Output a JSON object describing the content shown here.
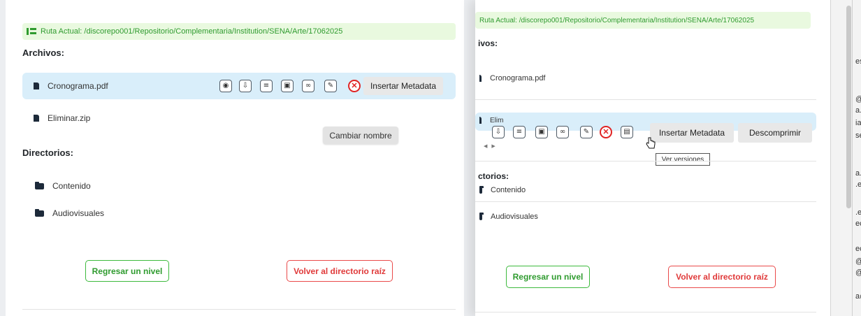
{
  "left_panel": {
    "path_label": "Ruta Actual:",
    "path_value": "/discorepo001/Repositorio/Complementaria/Institution/SENA/Arte/17062025",
    "files_title": "Archivos:",
    "files": [
      {
        "name": "Cronograma.pdf"
      },
      {
        "name": "Eliminar.zip"
      }
    ],
    "action_icons": [
      "eye-icon",
      "download-icon",
      "document-icon",
      "image-icon",
      "link-icon",
      "edit-icon",
      "delete-icon"
    ],
    "insert_metadata": "Insertar Metadata",
    "tooltip": "Cambiar nombre",
    "dirs_title": "Directorios:",
    "dirs": [
      {
        "name": "Contenido"
      },
      {
        "name": "Audiovisuales"
      }
    ],
    "back_button": "Regresar un nivel",
    "root_button": "Volver al directorio raíz"
  },
  "right_panel": {
    "path_label": "Ruta Actual:",
    "path_value": "/discorepo001/Repositorio/Complementaria/Institution/SENA/Arte/17062025",
    "files_title": "ivos:",
    "files": [
      {
        "name": "Cronograma.pdf"
      },
      {
        "name": "Elim"
      }
    ],
    "action_icons": [
      "download-icon",
      "document-icon",
      "image-icon",
      "link-icon",
      "edit-icon",
      "delete-icon",
      "versions-icon"
    ],
    "insert_metadata": "Insertar Metadata",
    "decompress": "Descomprimir",
    "tooltip": "Ver versiones",
    "dirs_title": "ctorios:",
    "dirs": [
      {
        "name": "Contenido"
      },
      {
        "name": "Audiovisuales"
      }
    ],
    "back_button": "Regresar un nivel",
    "root_button": "Volver al directorio raíz"
  },
  "side_fragments": [
    "es",
    "@s",
    "a.",
    "ia",
    "se",
    "a.",
    ".e",
    ".e",
    "ec",
    "ec",
    "@s",
    "@",
    "a@"
  ],
  "colors": {
    "accent_green": "#2f9b2f",
    "path_bg": "#e9f9df",
    "selected_row": "#d9eefa",
    "danger_red": "#e02424"
  }
}
